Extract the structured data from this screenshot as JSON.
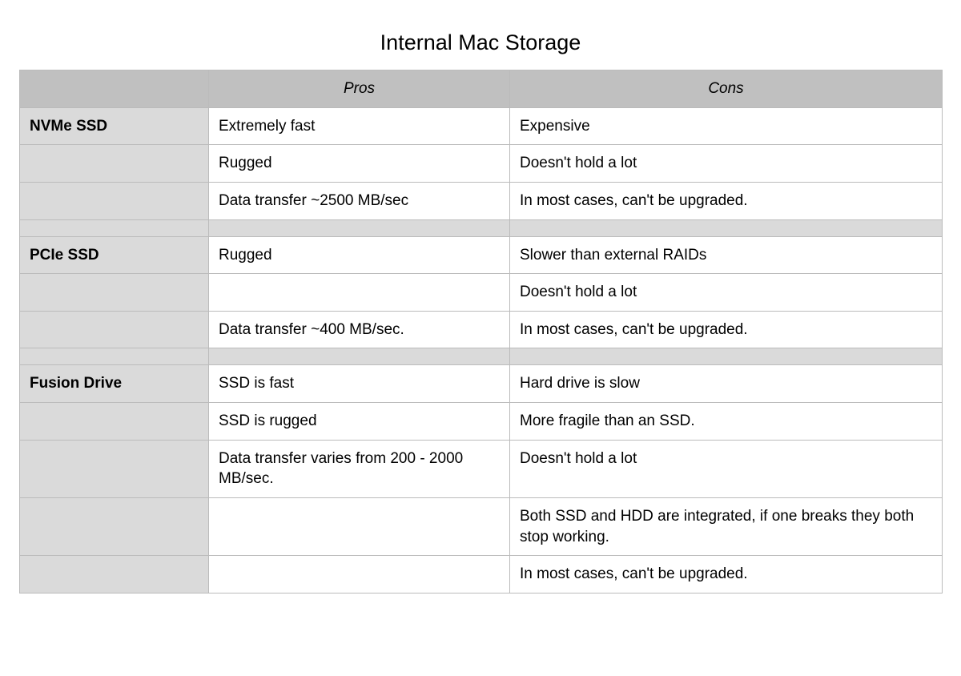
{
  "chart_data": {
    "type": "table",
    "title": "Internal Mac Storage",
    "headers": {
      "label": "",
      "pros": "Pros",
      "cons": "Cons"
    },
    "sections": [
      {
        "label": "NVMe SSD",
        "rows": [
          {
            "pro": "Extremely fast",
            "con": "Expensive"
          },
          {
            "pro": "Rugged",
            "con": "Doesn't hold a lot"
          },
          {
            "pro": "Data transfer ~2500 MB/sec",
            "con": "In most cases, can't be upgraded."
          }
        ]
      },
      {
        "label": "PCIe SSD",
        "rows": [
          {
            "pro": "Rugged",
            "con": "Slower than external RAIDs"
          },
          {
            "pro": "",
            "con": "Doesn't hold a lot"
          },
          {
            "pro": "Data transfer ~400 MB/sec.",
            "con": "In most cases, can't be upgraded."
          }
        ]
      },
      {
        "label": "Fusion Drive",
        "rows": [
          {
            "pro": "SSD is fast",
            "con": "Hard drive is slow"
          },
          {
            "pro": "SSD is rugged",
            "con": "More fragile than an SSD."
          },
          {
            "pro": "Data transfer varies from 200 - 2000 MB/sec.",
            "con": "Doesn't hold a lot"
          },
          {
            "pro": "",
            "con": "Both SSD and HDD are integrated, if one breaks they both stop working."
          },
          {
            "pro": "",
            "con": "In most cases, can't be upgraded."
          }
        ]
      }
    ]
  }
}
